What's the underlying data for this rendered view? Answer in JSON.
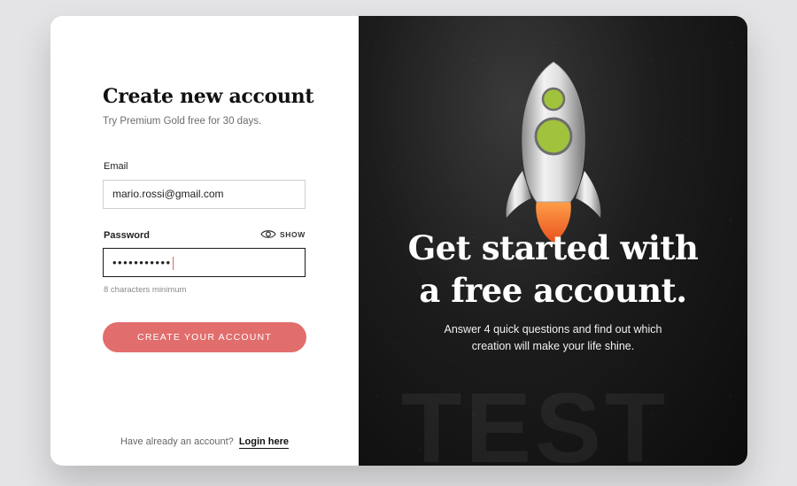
{
  "form": {
    "title": "Create new account",
    "subtitle": "Try Premium Gold free for 30 days.",
    "email_label": "Email",
    "email_value": "mario.rossi@gmail.com",
    "password_label": "Password",
    "password_value": "•••••••••••",
    "show_label": "SHOW",
    "hint": "8 characters minimum",
    "submit_label": "CREATE YOUR ACCOUNT",
    "footer_text": "Have already an account?",
    "login_label": "Login here"
  },
  "hero": {
    "headline_line1": "Get started with",
    "headline_line2": "a free account.",
    "tagline_line1": "Answer 4 quick questions and find out which",
    "tagline_line2": "creation will make your life shine.",
    "watermark": "TEST"
  },
  "colors": {
    "accent": "#e26d6d",
    "rocket_window": "#a0c23c",
    "flame": "#f07a2c"
  },
  "icons": {
    "show_password": "eye-icon",
    "illustration": "rocket-icon"
  }
}
